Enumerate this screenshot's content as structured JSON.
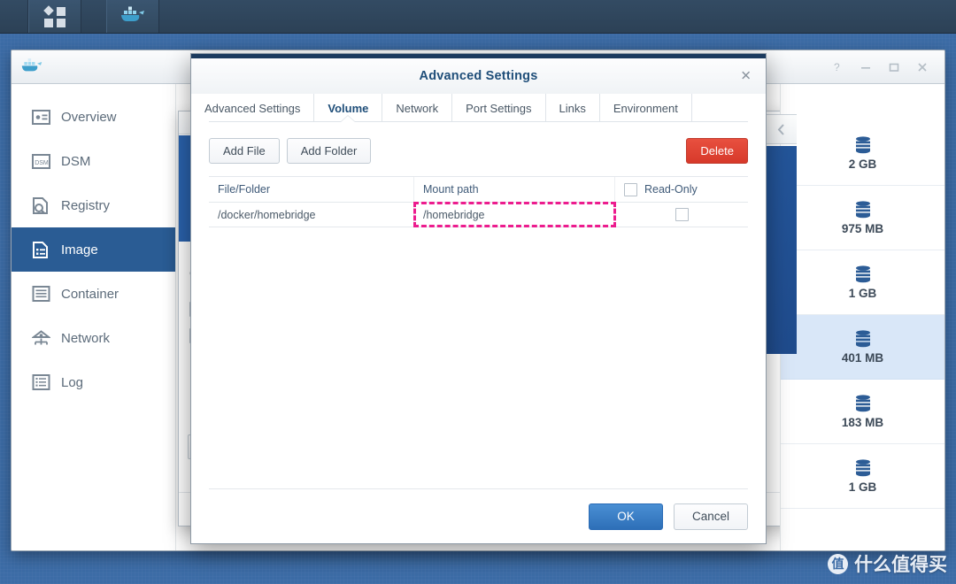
{
  "taskbar": {
    "items": [
      {
        "name": "apps-grid",
        "label": ""
      },
      {
        "name": "docker-app",
        "label": ""
      }
    ]
  },
  "main_window": {
    "app_icon": "docker-whale-icon",
    "window_controls": [
      {
        "name": "help",
        "glyph": "?"
      },
      {
        "name": "minimize",
        "glyph": "—"
      },
      {
        "name": "maximize",
        "glyph": "□"
      },
      {
        "name": "close",
        "glyph": "✕"
      }
    ],
    "sidebar": {
      "items": [
        {
          "label": "Overview",
          "icon": "overview-icon",
          "active": false
        },
        {
          "label": "DSM",
          "icon": "dsm-icon",
          "active": false
        },
        {
          "label": "Registry",
          "icon": "registry-icon",
          "active": false
        },
        {
          "label": "Image",
          "icon": "image-icon",
          "active": true
        },
        {
          "label": "Container",
          "icon": "container-icon",
          "active": false
        },
        {
          "label": "Network",
          "icon": "network-icon",
          "active": false
        },
        {
          "label": "Log",
          "icon": "log-icon",
          "active": false
        }
      ]
    },
    "background_dialog": {
      "letter": "C"
    },
    "image_list": {
      "rows": [
        {
          "size": "2 GB",
          "selected": false
        },
        {
          "size": "975 MB",
          "selected": false
        },
        {
          "size": "1 GB",
          "selected": false
        },
        {
          "size": "401 MB",
          "selected": true
        },
        {
          "size": "183 MB",
          "selected": false
        },
        {
          "size": "1 GB",
          "selected": false
        }
      ]
    }
  },
  "modal": {
    "title": "Advanced Settings",
    "close_label": "✕",
    "tabs": [
      {
        "label": "Advanced Settings",
        "active": false
      },
      {
        "label": "Volume",
        "active": true
      },
      {
        "label": "Network",
        "active": false
      },
      {
        "label": "Port Settings",
        "active": false
      },
      {
        "label": "Links",
        "active": false
      },
      {
        "label": "Environment",
        "active": false
      }
    ],
    "toolbar": {
      "add_file_label": "Add File",
      "add_folder_label": "Add Folder",
      "delete_label": "Delete"
    },
    "table": {
      "columns": {
        "file_folder": "File/Folder",
        "mount_path": "Mount path",
        "read_only": "Read-Only"
      },
      "rows": [
        {
          "file_folder": "/docker/homebridge",
          "mount_path": "/homebridge",
          "read_only": false,
          "mount_path_highlighted": true
        }
      ],
      "header_read_only_checked": false
    },
    "footer": {
      "ok_label": "OK",
      "cancel_label": "Cancel"
    }
  },
  "watermark": {
    "badge": "值",
    "text": "什么值得买"
  },
  "colors": {
    "desktop": "#3c6ca6",
    "taskbar": "#2C4156",
    "accent_blue": "#2A5C94",
    "modal_topbar": "#1B3A5E",
    "title_blue": "#1F4E79",
    "danger_red": "#D7392A",
    "primary_blue": "#2E6FB8",
    "highlight_pink": "#EC1C8E",
    "row_selected": "#D9E7F8"
  }
}
